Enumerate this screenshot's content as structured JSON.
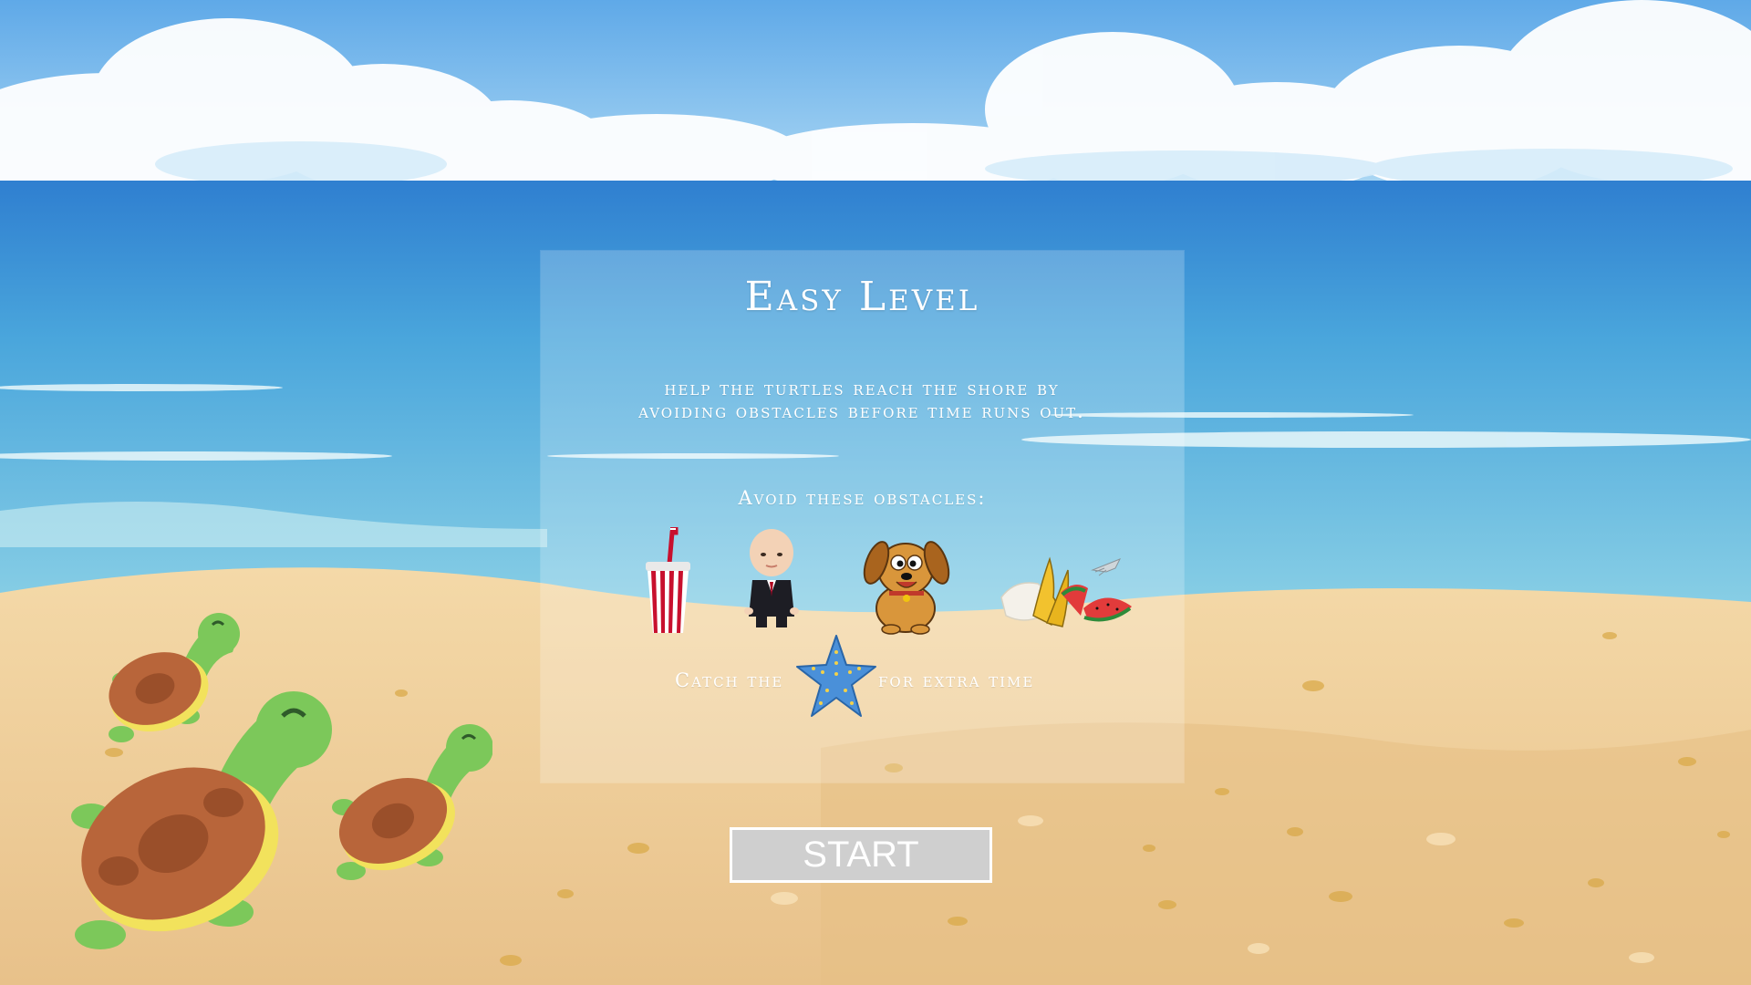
{
  "level": {
    "title": "Easy Level",
    "instructions": "Help the turtles reach the shore by avoiding obstacles before time runs out.",
    "avoid_heading": "Avoid these obstacles:",
    "catch_prefix": "Catch the",
    "catch_suffix": "for extra time"
  },
  "obstacles": [
    {
      "name": "soda-cup",
      "icon": "soda-cup-icon"
    },
    {
      "name": "boss-baby",
      "icon": "baby-icon"
    },
    {
      "name": "dog",
      "icon": "dog-icon"
    },
    {
      "name": "food-waste",
      "icon": "food-waste-icon"
    }
  ],
  "bonus": {
    "icon": "starfish-icon"
  },
  "start_button": {
    "label": "START"
  },
  "colors": {
    "sky": "#6cb6ea",
    "sea": "#3b8fd6",
    "sand": "#efcb92",
    "turtle_shell": "#b8653a",
    "turtle_skin": "#7cc85a",
    "button_bg": "#cfcfcf"
  }
}
